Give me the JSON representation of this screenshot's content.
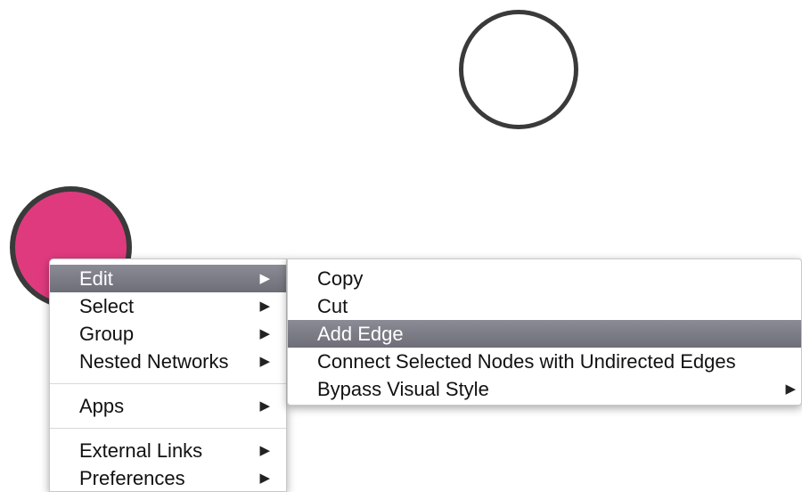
{
  "main_menu": {
    "items": [
      {
        "label": "Edit",
        "arrow": "▶"
      },
      {
        "label": "Select",
        "arrow": "▶"
      },
      {
        "label": "Group",
        "arrow": "▶"
      },
      {
        "label": "Nested Networks",
        "arrow": "▶"
      },
      {
        "label": "Apps",
        "arrow": "▶"
      },
      {
        "label": "External Links",
        "arrow": "▶"
      },
      {
        "label": "Preferences",
        "arrow": "▶"
      }
    ],
    "selected": "Edit"
  },
  "submenu": {
    "items": [
      {
        "label": "Copy"
      },
      {
        "label": "Cut"
      },
      {
        "label": "Add Edge"
      },
      {
        "label": "Connect Selected Nodes with Undirected Edges"
      },
      {
        "label": "Bypass Visual Style",
        "arrow": "▶"
      }
    ],
    "selected": "Add Edge"
  },
  "colors": {
    "node_fill": "#e03a7e",
    "node_border": "#3a3a3a",
    "highlight": "#7b7c86"
  }
}
